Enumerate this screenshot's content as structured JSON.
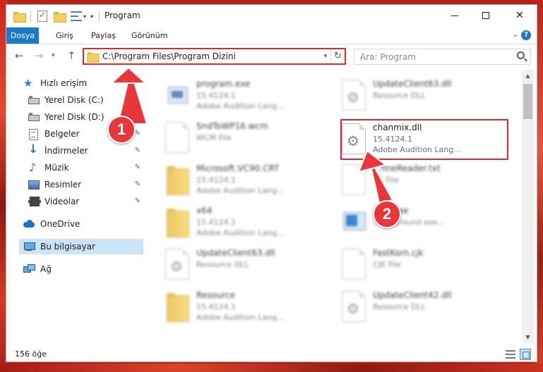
{
  "window": {
    "title": "Program",
    "minimize_label": "—",
    "close_label": "✕"
  },
  "ribbon": {
    "tabs": [
      "Dosya",
      "Giriş",
      "Paylaş",
      "Görünüm"
    ],
    "help": "?"
  },
  "navbar": {
    "back": "←",
    "forward": "→",
    "recent": "▾",
    "up": "↑",
    "address": "C:\\Program Files\\Program Dizini",
    "refresh": "↻",
    "search_placeholder": "Ara: Program"
  },
  "sidebar": {
    "quick_access": "Hızlı erişim",
    "items": [
      {
        "label": "Yerel Disk (C:)",
        "icon": "disk-icon"
      },
      {
        "label": "Yerel Disk (D:)",
        "icon": "disk-icon"
      },
      {
        "label": "Belgeler",
        "icon": "documents-icon"
      },
      {
        "label": "İndirmeler",
        "icon": "downloads-icon"
      },
      {
        "label": "Müzik",
        "icon": "music-icon"
      },
      {
        "label": "Resimler",
        "icon": "pictures-icon"
      },
      {
        "label": "Videolar",
        "icon": "videos-icon"
      }
    ],
    "pin_glyph": "📌",
    "onedrive": "OneDrive",
    "this_pc": "Bu bilgisayar",
    "network": "Ağ"
  },
  "files": {
    "left": [
      {
        "name": "program.exe",
        "line2": "15.4124.1",
        "line3": "Adobe Audition Lang...",
        "icon": "exe"
      },
      {
        "name": "SndToWP16.wcm",
        "line2": "WCM File",
        "line3": "",
        "icon": "page"
      },
      {
        "name": "Microsoft.VC90.CRT",
        "line2": "15.4124.1",
        "line3": "Adobe Audition Lang...",
        "icon": "folder"
      },
      {
        "name": "x64",
        "line2": "15.4124.1",
        "line3": "Adobe Audition Lang...",
        "icon": "folder"
      },
      {
        "name": "UpdateClient63.dll",
        "line2": "Resource DLL",
        "line3": "",
        "icon": "dll"
      },
      {
        "name": "Resource",
        "line2": "15.4124.1",
        "line3": "Adobe Audition Lang...",
        "icon": "folder"
      }
    ],
    "right": [
      {
        "name": "UpdateClient63.dll",
        "line2": "Resource DLL",
        "line3": "",
        "icon": "dll"
      },
      {
        "name": "...fineReader.txt",
        "line2": "...t File",
        "line3": "",
        "icon": "page"
      },
      {
        "name": "...ec.exe",
        "line2": "...ackground exe...",
        "line3": "",
        "icon": "winexe"
      },
      {
        "name": "FastKorn.cjk",
        "line2": "CJK File",
        "line3": "",
        "icon": "page"
      },
      {
        "name": "UpdateClient42.dll",
        "line2": "Resource DLL",
        "line3": "",
        "icon": "dll"
      }
    ],
    "highlighted": {
      "name": "chanmix.dll",
      "line2": "15.4124.1",
      "line3": "Adobe Audition Lang..."
    }
  },
  "status": {
    "item_count": "156 öğe"
  },
  "annotations": {
    "step1": "1",
    "step2": "2"
  },
  "colors": {
    "accent": "#1979ca",
    "highlight_border": "#e4262c",
    "annotation": "#e8363a"
  }
}
